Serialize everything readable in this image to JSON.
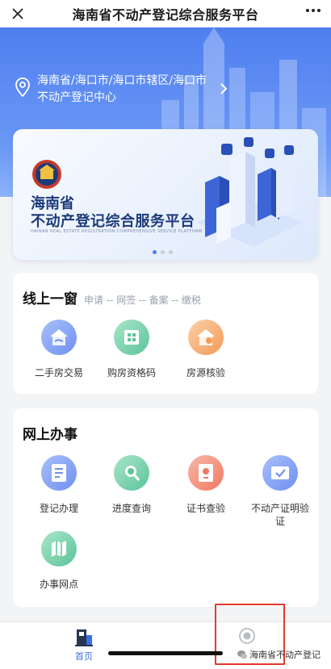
{
  "nav": {
    "close_icon": "close-icon",
    "title": "海南省不动产登记综合服务平台",
    "more_icon": "more-icon"
  },
  "location": {
    "text": "海南省/海口市/海口市辖区/海口市不动产登记中心",
    "icon": "location-pin-icon",
    "arrow_icon": "chevron-right-icon"
  },
  "banner": {
    "title_line1": "海南省",
    "title_line2": "不动产登记综合服务平台",
    "subtitle": "HAINAN REAL ESTATE REGISTRATION COMPREHENSIVE SERVICE PLATFORM",
    "slides": 3,
    "active_slide": 1
  },
  "online_window": {
    "title": "线上一窗",
    "subtitle": "申请 -- 网签 -- 备案 -- 缴税",
    "items": [
      {
        "label": "二手房交易",
        "icon": "house-trade-icon",
        "color": "#6f8ff0"
      },
      {
        "label": "购房资格码",
        "icon": "qr-code-icon",
        "color": "#5cc49a"
      },
      {
        "label": "房源核验",
        "icon": "house-check-icon",
        "color": "#f39a56"
      }
    ]
  },
  "online_service": {
    "title": "网上办事",
    "items": [
      {
        "label": "登记办理",
        "icon": "document-icon",
        "color": "#6f8ff0"
      },
      {
        "label": "进度查询",
        "icon": "magnifier-icon",
        "color": "#5cc49a"
      },
      {
        "label": "证书查验",
        "icon": "certificate-icon",
        "color": "#f07860"
      },
      {
        "label": "不动产证明验证",
        "icon": "verify-card-icon",
        "color": "#6f8ff0"
      },
      {
        "label": "办事网点",
        "icon": "map-pin-icon",
        "color": "#5cc49a"
      }
    ]
  },
  "tabbar": {
    "home_label": "首页",
    "home_icon": "home-building-icon",
    "profile_icon": "profile-circle-icon"
  },
  "watermark": "海南省不动产登记",
  "colors": {
    "primary": "#4f7ff0",
    "highlight": "#e23a2e"
  }
}
